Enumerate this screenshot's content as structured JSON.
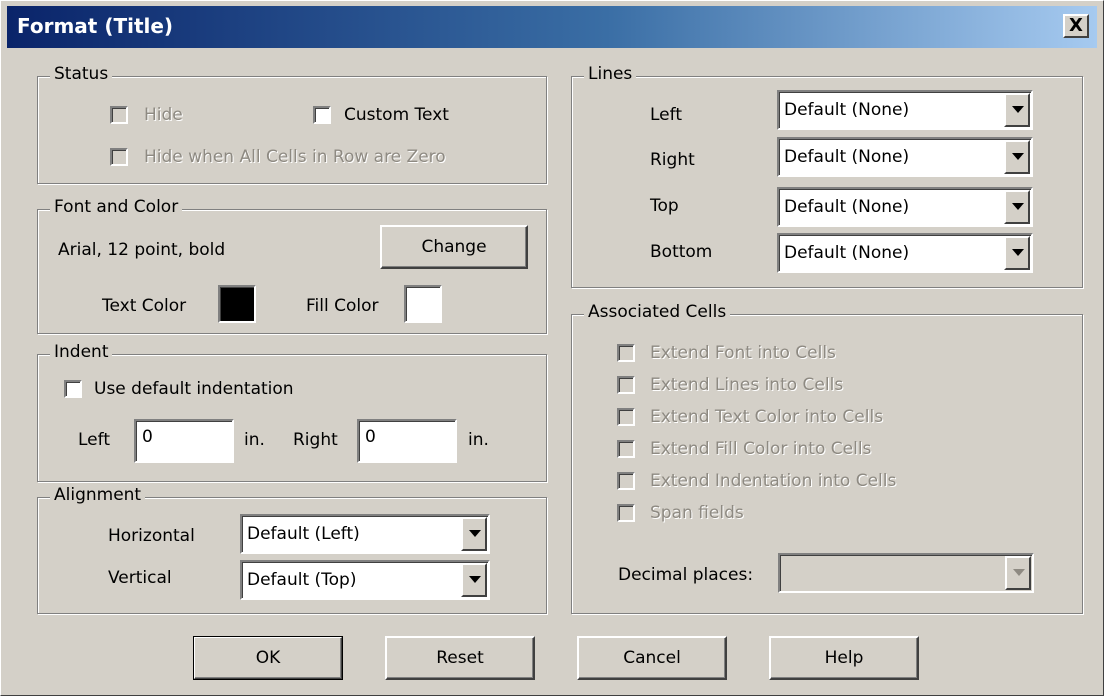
{
  "window": {
    "title": "Format (Title)",
    "close_label": "X"
  },
  "status": {
    "legend": "Status",
    "hide_label": "Hide",
    "custom_text_label": "Custom Text",
    "hide_zero_label": "Hide when All Cells in Row are Zero"
  },
  "font_color": {
    "legend": "Font and Color",
    "font_desc": "Arial, 12 point, bold",
    "change_label": "Change",
    "text_color_label": "Text Color",
    "fill_color_label": "Fill Color",
    "text_color": "#000000",
    "fill_color": "#ffffff"
  },
  "indent": {
    "legend": "Indent",
    "use_default_label": "Use default indentation",
    "left_label": "Left",
    "left_value": "0",
    "left_unit": "in.",
    "right_label": "Right",
    "right_value": "0",
    "right_unit": "in."
  },
  "alignment": {
    "legend": "Alignment",
    "horizontal_label": "Horizontal",
    "horizontal_value": "Default (Left)",
    "vertical_label": "Vertical",
    "vertical_value": "Default (Top)"
  },
  "lines": {
    "legend": "Lines",
    "left_label": "Left",
    "left_value": "Default (None)",
    "right_label": "Right",
    "right_value": "Default (None)",
    "top_label": "Top",
    "top_value": "Default (None)",
    "bottom_label": "Bottom",
    "bottom_value": "Default (None)"
  },
  "associated": {
    "legend": "Associated Cells",
    "items": [
      "Extend Font into Cells",
      "Extend Lines into Cells",
      "Extend Text Color into Cells",
      "Extend Fill Color into Cells",
      "Extend Indentation into Cells",
      "Span fields"
    ],
    "decimal_label": "Decimal places:",
    "decimal_value": ""
  },
  "buttons": {
    "ok": "OK",
    "reset": "Reset",
    "cancel": "Cancel",
    "help": "Help"
  }
}
